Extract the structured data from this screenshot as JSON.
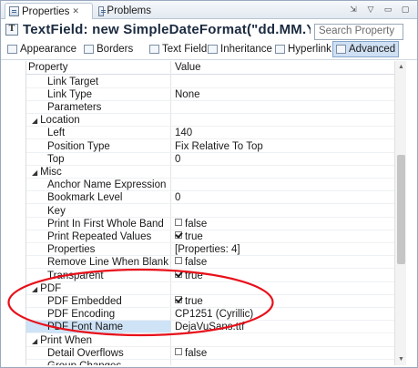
{
  "tabs": {
    "properties": "Properties",
    "properties_close": "✕",
    "problems": "Problems"
  },
  "view_buttons": [
    "⇲",
    "▽",
    "▭",
    "▢"
  ],
  "title": "TextField: new SimpleDateFormat(\"dd.MM.YY",
  "search": {
    "text": "Search Property"
  },
  "section_tabs": [
    "Appearance",
    "Borders",
    "Text Field",
    "Inheritance",
    "Hyperlink",
    "Advanced"
  ],
  "selected_section": "Advanced",
  "table": {
    "header": {
      "property": "Property",
      "value": "Value"
    },
    "rows": [
      {
        "kind": "prop",
        "name": "Link Target",
        "value": ""
      },
      {
        "kind": "prop",
        "name": "Link Type",
        "value": "None"
      },
      {
        "kind": "prop",
        "name": "Parameters",
        "value": ""
      },
      {
        "kind": "cat",
        "name": "Location",
        "twist": "◢"
      },
      {
        "kind": "prop",
        "name": "Left",
        "value": "140"
      },
      {
        "kind": "prop",
        "name": "Position Type",
        "value": "Fix Relative To Top"
      },
      {
        "kind": "prop",
        "name": "Top",
        "value": "0"
      },
      {
        "kind": "cat",
        "name": "Misc",
        "twist": "◢"
      },
      {
        "kind": "prop",
        "name": "Anchor Name Expression",
        "value": ""
      },
      {
        "kind": "prop",
        "name": "Bookmark Level",
        "value": "0"
      },
      {
        "kind": "prop",
        "name": "Key",
        "value": ""
      },
      {
        "kind": "prop",
        "name": "Print In First Whole Band",
        "checkbox": false,
        "value": "false"
      },
      {
        "kind": "prop",
        "name": "Print Repeated Values",
        "checkbox": true,
        "value": "true"
      },
      {
        "kind": "prop",
        "name": "Properties",
        "value": "[Properties: 4]"
      },
      {
        "kind": "prop",
        "name": "Remove Line When Blank",
        "checkbox": false,
        "value": "false"
      },
      {
        "kind": "prop",
        "name": "Transparent",
        "checkbox": true,
        "value": "true"
      },
      {
        "kind": "cat",
        "name": "PDF",
        "twist": "◢"
      },
      {
        "kind": "prop",
        "name": "PDF Embedded",
        "checkbox": true,
        "value": "true"
      },
      {
        "kind": "prop",
        "name": "PDF Encoding",
        "value": "CP1251 (Cyrillic)"
      },
      {
        "kind": "prop",
        "name": "PDF Font Name",
        "value": "DejaVuSans.ttf",
        "selected": true
      },
      {
        "kind": "cat",
        "name": "Print When",
        "twist": "◢"
      },
      {
        "kind": "prop",
        "name": "Detail Overflows",
        "checkbox": false,
        "value": "false"
      },
      {
        "kind": "prop",
        "name": "Group Changes",
        "value": ""
      }
    ]
  },
  "colors": {
    "annotation": "#e8101a",
    "selection": "#cfe3f6",
    "accent": "#86a6cc"
  }
}
